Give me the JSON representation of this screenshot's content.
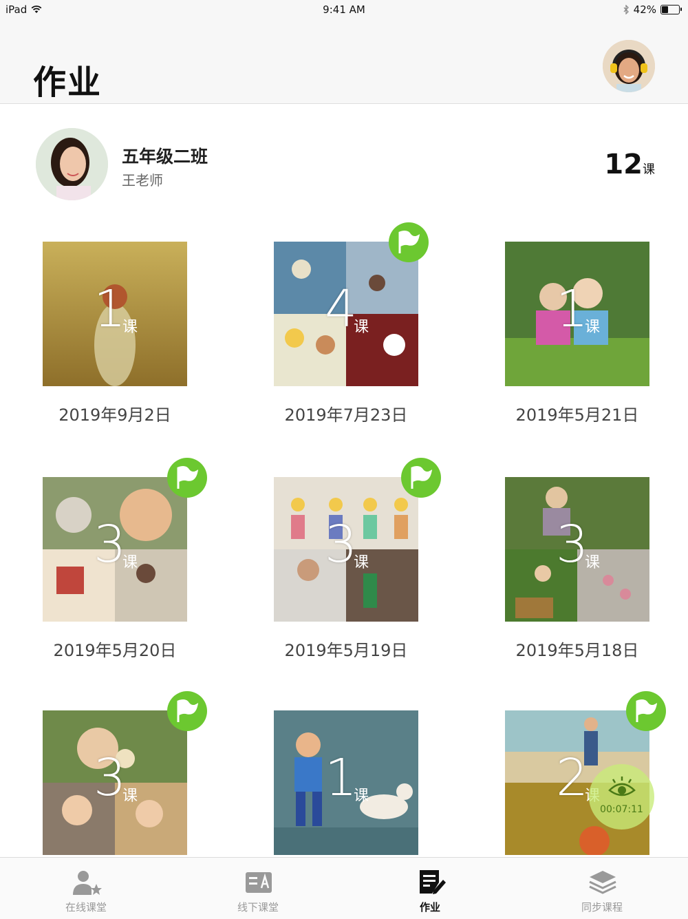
{
  "status_bar": {
    "device": "iPad",
    "time": "9:41 AM",
    "battery": "42%",
    "battery_fraction": 0.42
  },
  "header": {
    "title": "作业"
  },
  "teacher": {
    "class_name": "五年级二班",
    "teacher_name": "王老师",
    "lesson_count": "12",
    "lesson_unit": "课"
  },
  "cards": [
    {
      "count": "1",
      "unit": "课",
      "date": "2019年9月2日",
      "flag": false
    },
    {
      "count": "4",
      "unit": "课",
      "date": "2019年7月23日",
      "flag": true
    },
    {
      "count": "1",
      "unit": "课",
      "date": "2019年5月21日",
      "flag": false
    },
    {
      "count": "3",
      "unit": "课",
      "date": "2019年5月20日",
      "flag": true
    },
    {
      "count": "3",
      "unit": "课",
      "date": "2019年5月19日",
      "flag": true
    },
    {
      "count": "3",
      "unit": "课",
      "date": "2019年5月18日",
      "flag": false
    },
    {
      "count": "3",
      "unit": "课",
      "date": "",
      "flag": true
    },
    {
      "count": "1",
      "unit": "课",
      "date": "",
      "flag": false
    },
    {
      "count": "2",
      "unit": "课",
      "date": "",
      "flag": true
    }
  ],
  "floating_timer": {
    "time": "00:07:11"
  },
  "tabs": [
    {
      "label": "在线课堂",
      "icon": "online-class-icon",
      "active": false
    },
    {
      "label": "线下课堂",
      "icon": "offline-class-icon",
      "active": false
    },
    {
      "label": "作业",
      "icon": "homework-icon",
      "active": true
    },
    {
      "label": "同步课程",
      "icon": "sync-course-icon",
      "active": false
    }
  ],
  "colors": {
    "accent_green": "#6cc830",
    "tab_inactive": "#999999",
    "tab_active": "#111111"
  }
}
